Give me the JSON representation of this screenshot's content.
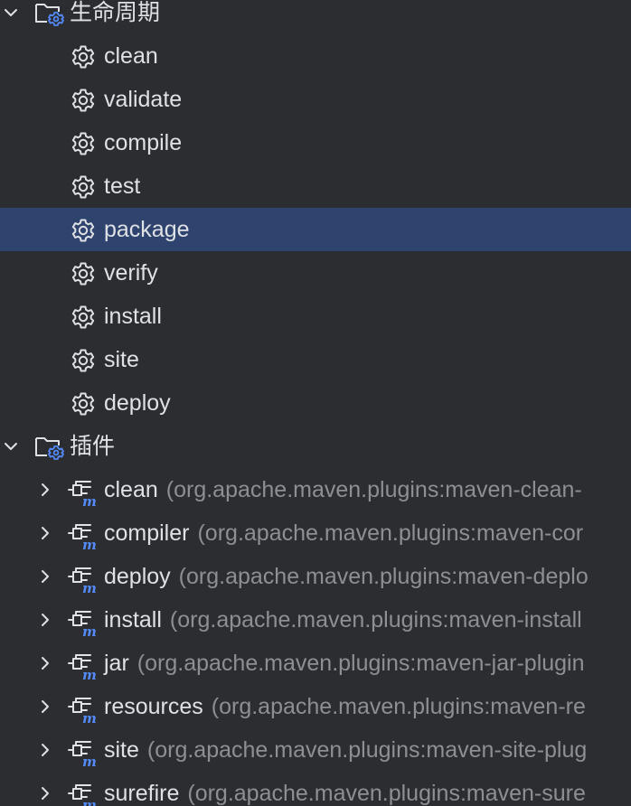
{
  "colors": {
    "background": "#2b2d30",
    "selection": "#2e436e",
    "text": "#dfe1e5",
    "secondary_text": "#8c8f94",
    "accent_blue": "#548af7"
  },
  "lifecycle": {
    "label": "生命周期",
    "expanded": true,
    "icon": "folder-gear-icon",
    "items": [
      {
        "name": "clean",
        "icon": "gear-icon"
      },
      {
        "name": "validate",
        "icon": "gear-icon"
      },
      {
        "name": "compile",
        "icon": "gear-icon"
      },
      {
        "name": "test",
        "icon": "gear-icon"
      },
      {
        "name": "package",
        "icon": "gear-icon",
        "selected": true
      },
      {
        "name": "verify",
        "icon": "gear-icon"
      },
      {
        "name": "install",
        "icon": "gear-icon"
      },
      {
        "name": "site",
        "icon": "gear-icon"
      },
      {
        "name": "deploy",
        "icon": "gear-icon"
      }
    ]
  },
  "plugins": {
    "label": "插件",
    "expanded": true,
    "icon": "folder-gear-icon",
    "items": [
      {
        "name": "clean",
        "coord": "(org.apache.maven.plugins:maven-clean-",
        "icon": "maven-plugin-icon"
      },
      {
        "name": "compiler",
        "coord": "(org.apache.maven.plugins:maven-cor",
        "icon": "maven-plugin-icon"
      },
      {
        "name": "deploy",
        "coord": "(org.apache.maven.plugins:maven-deplo",
        "icon": "maven-plugin-icon"
      },
      {
        "name": "install",
        "coord": "(org.apache.maven.plugins:maven-install",
        "icon": "maven-plugin-icon"
      },
      {
        "name": "jar",
        "coord": "(org.apache.maven.plugins:maven-jar-plugin",
        "icon": "maven-plugin-icon"
      },
      {
        "name": "resources",
        "coord": "(org.apache.maven.plugins:maven-re",
        "icon": "maven-plugin-icon"
      },
      {
        "name": "site",
        "coord": "(org.apache.maven.plugins:maven-site-plug",
        "icon": "maven-plugin-icon"
      },
      {
        "name": "surefire",
        "coord": "(org.apache.maven.plugins:maven-sure",
        "icon": "maven-plugin-icon"
      }
    ]
  }
}
